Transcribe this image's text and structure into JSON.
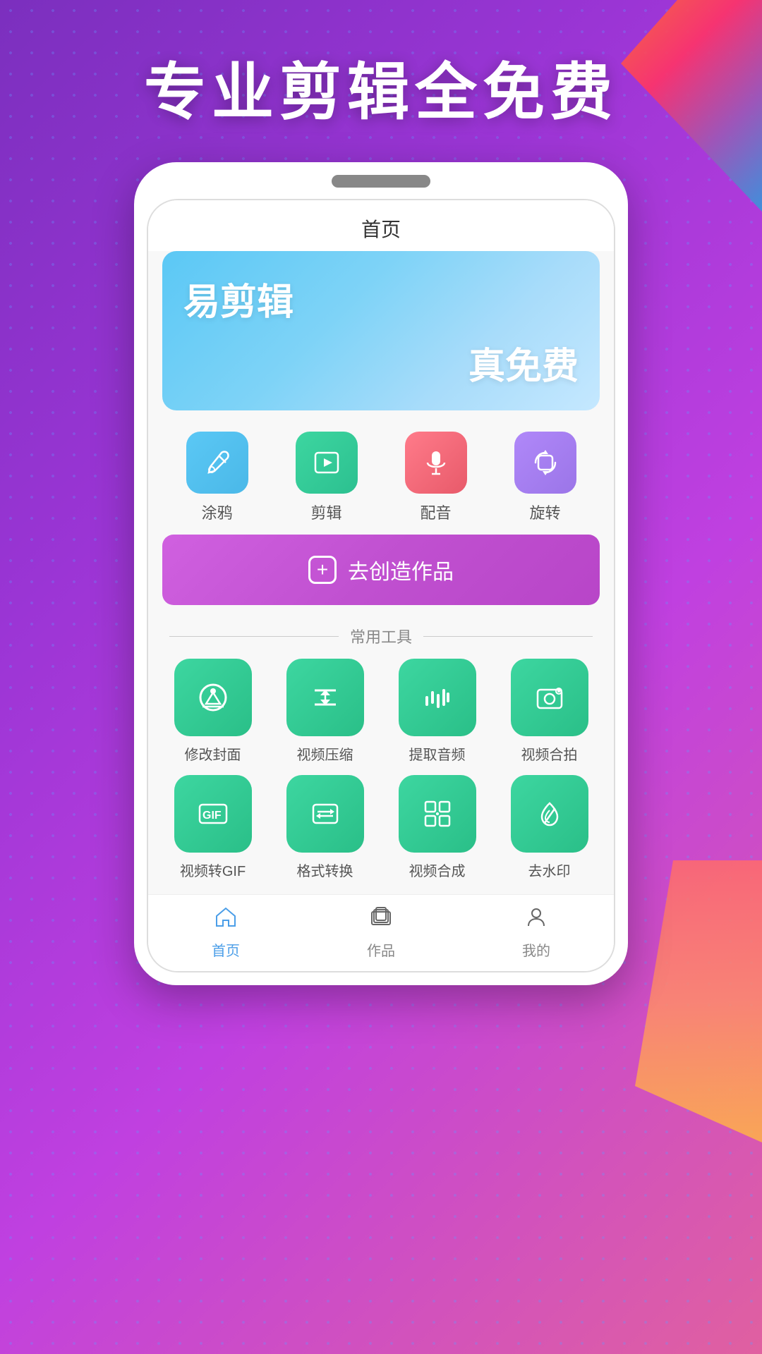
{
  "hero": {
    "text": "专业剪辑全免费"
  },
  "phone": {
    "header": {
      "title": "首页"
    },
    "banner": {
      "title": "易剪辑",
      "subtitle": "真免费"
    },
    "quick_tools": [
      {
        "id": "graffiti",
        "label": "涂鸦",
        "color_class": "icon-blue",
        "icon": "✏"
      },
      {
        "id": "edit",
        "label": "剪辑",
        "color_class": "icon-green",
        "icon": "▶"
      },
      {
        "id": "dubbing",
        "label": "配音",
        "color_class": "icon-red",
        "icon": "🎤"
      },
      {
        "id": "rotate",
        "label": "旋转",
        "color_class": "icon-purple",
        "icon": "↻"
      }
    ],
    "create_button": {
      "label": "去创造作品"
    },
    "section_title": "常用工具",
    "grid_tools": [
      {
        "id": "cover",
        "label": "修改封面",
        "icon": "🎓"
      },
      {
        "id": "compress",
        "label": "视频压缩",
        "icon": "⬇"
      },
      {
        "id": "audio",
        "label": "提取音频",
        "icon": "🎵"
      },
      {
        "id": "collab",
        "label": "视频合拍",
        "icon": "📷"
      },
      {
        "id": "gif",
        "label": "视频转GIF",
        "icon": "GIF"
      },
      {
        "id": "convert",
        "label": "格式转换",
        "icon": "↔"
      },
      {
        "id": "compose",
        "label": "视频合成",
        "icon": "⊞"
      },
      {
        "id": "watermark",
        "label": "去水印",
        "icon": "💧"
      }
    ],
    "bottom_nav": [
      {
        "id": "home",
        "label": "首页",
        "active": true,
        "icon": "⌂"
      },
      {
        "id": "works",
        "label": "作品",
        "active": false,
        "icon": "⧉"
      },
      {
        "id": "mine",
        "label": "我的",
        "active": false,
        "icon": "👤"
      }
    ]
  }
}
